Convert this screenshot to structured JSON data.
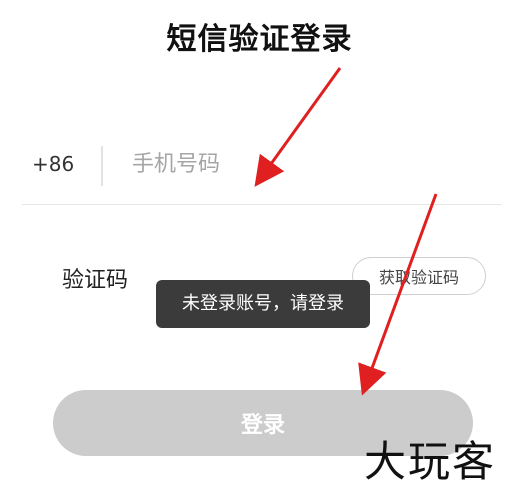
{
  "page": {
    "title": "短信验证登录"
  },
  "phone": {
    "country_code": "+86",
    "placeholder": "手机号码",
    "value": ""
  },
  "code": {
    "label": "验证码",
    "get_code_label": "获取验证码"
  },
  "toast": {
    "message": "未登录账号，请登录"
  },
  "login": {
    "label": "登录"
  },
  "watermark": {
    "text": "大玩客"
  },
  "colors": {
    "annotation_arrow": "#e02020",
    "login_button_disabled": "#cccccc",
    "toast_background": "#3b3b3b"
  }
}
